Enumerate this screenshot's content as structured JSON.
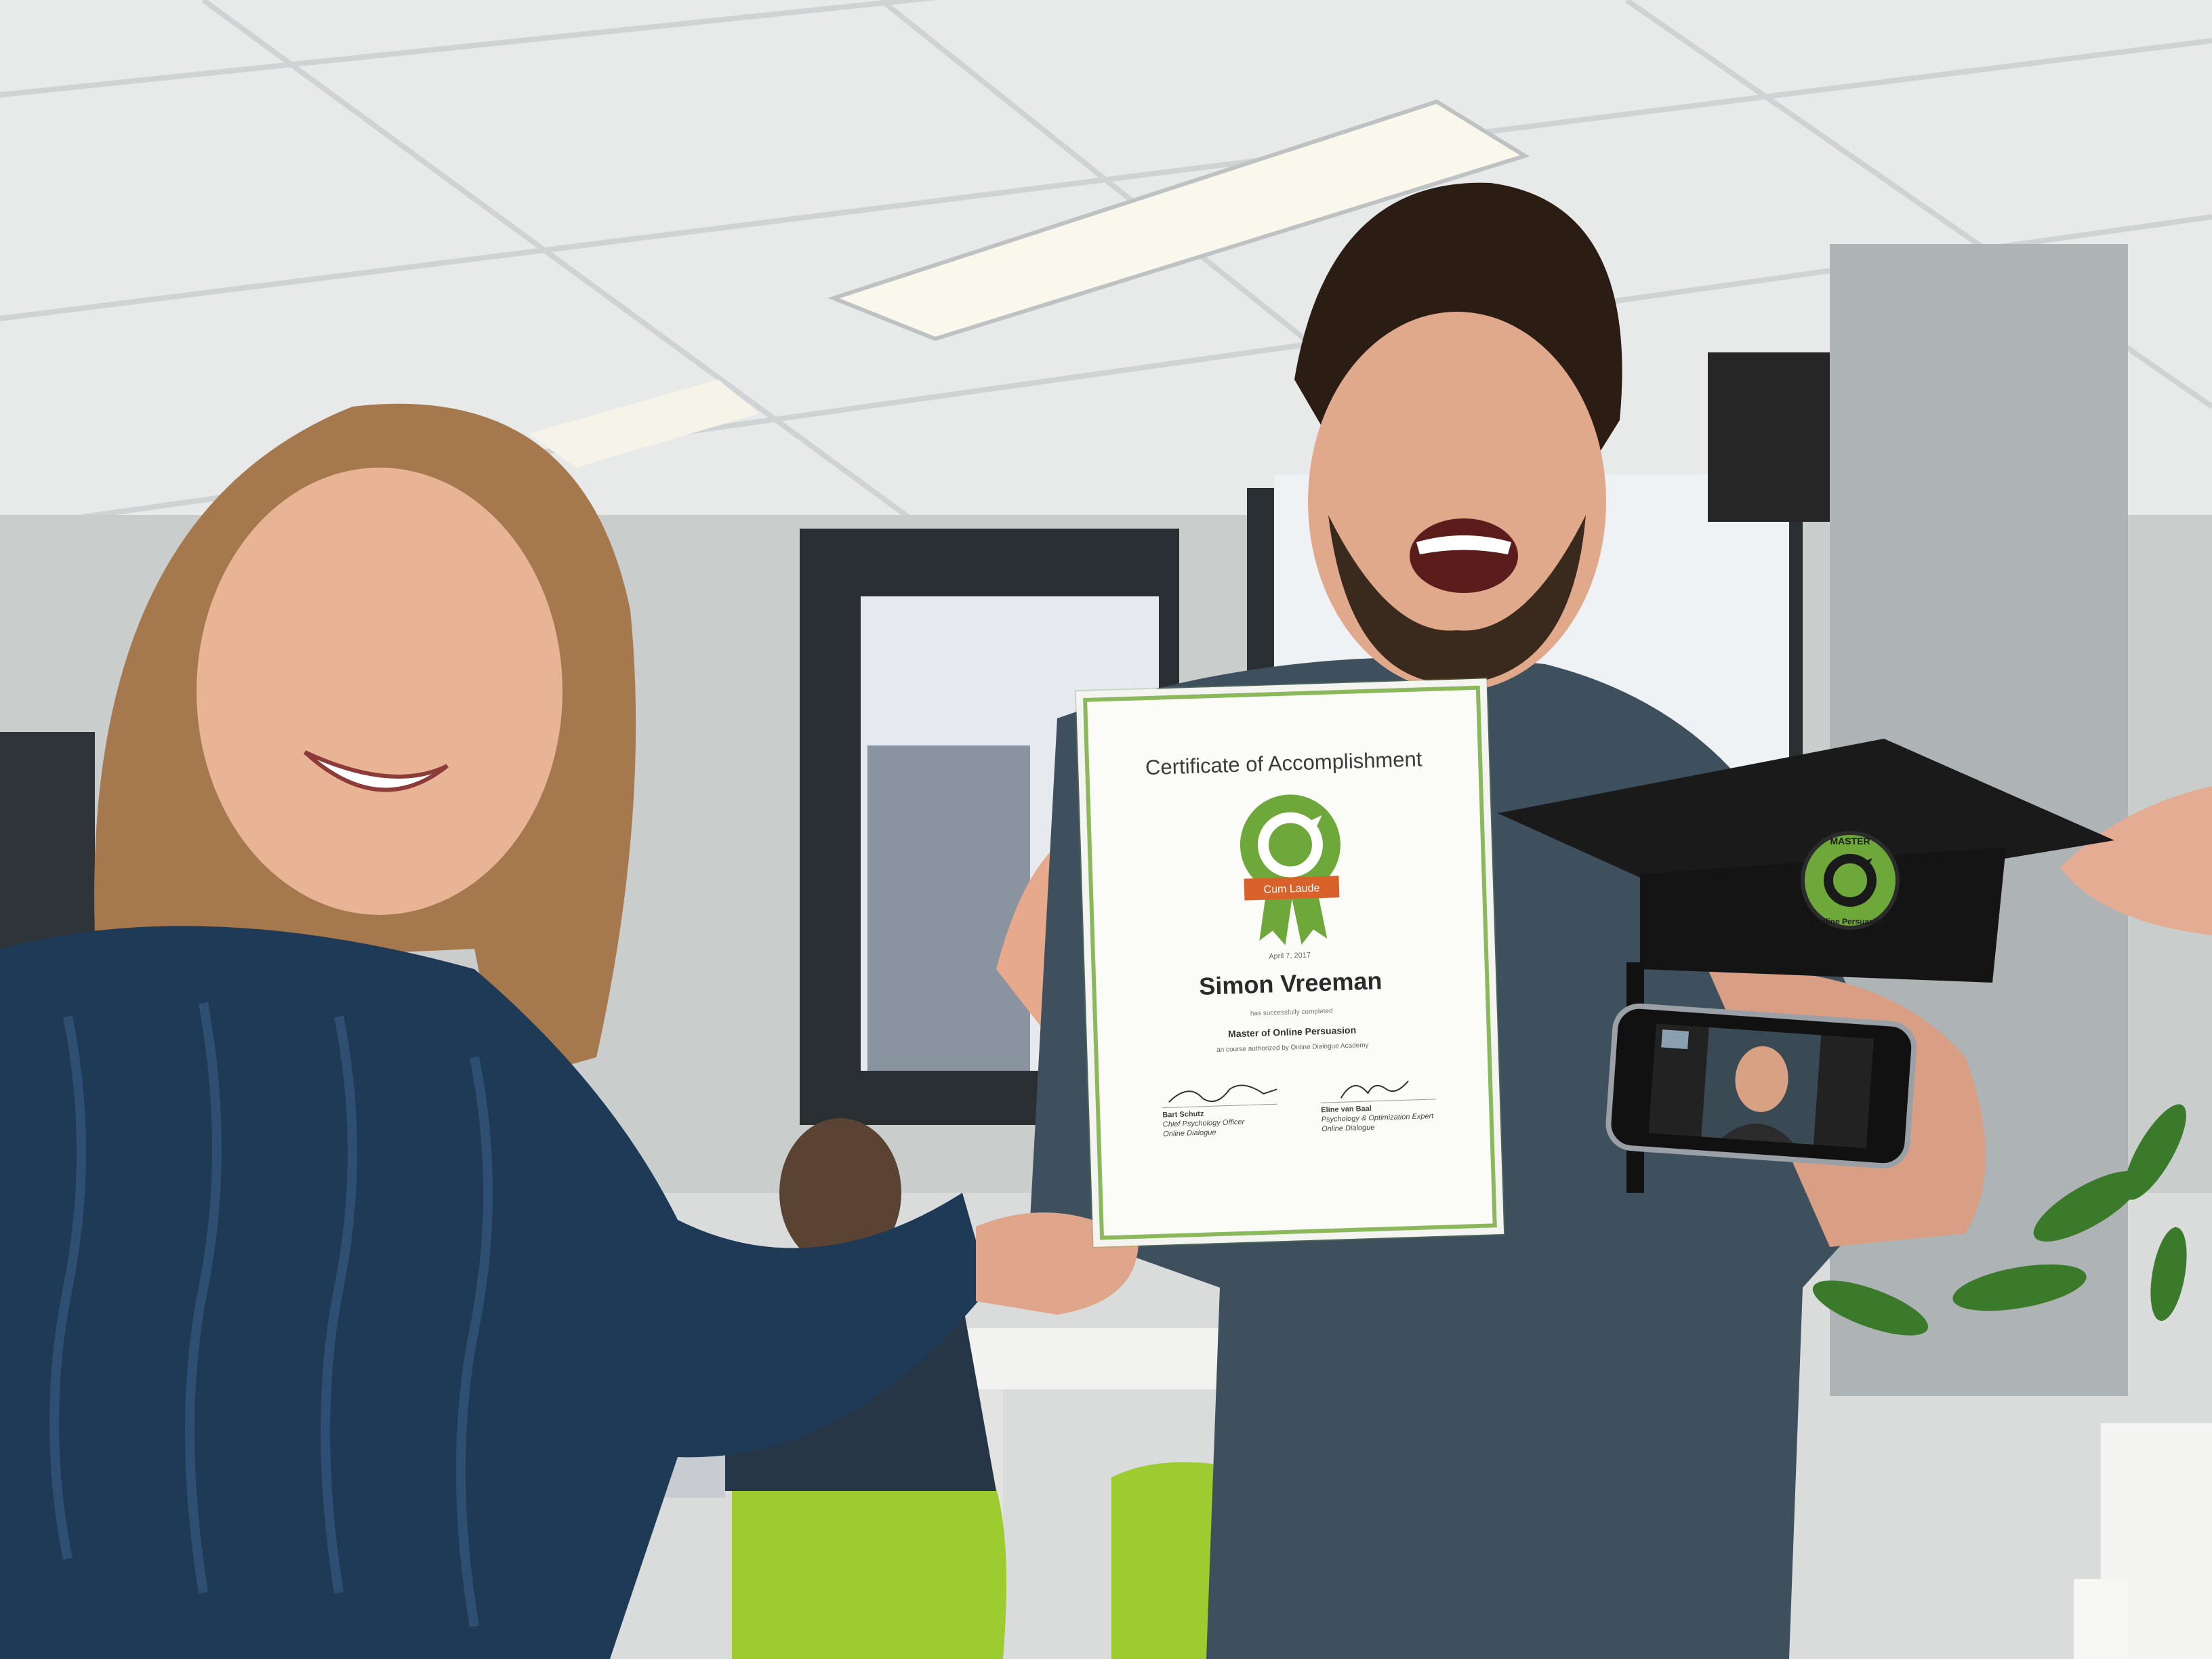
{
  "certificate": {
    "title": "Certificate of Accomplishment",
    "badge": "Cum Laude",
    "date": "April 7, 2017",
    "recipient": "Simon Vreeman",
    "completed_text": "has successfully completed",
    "course": "Master of Online Persuasion",
    "authorized_text": "an course authorized by Online Dialogue Academy",
    "signatories": [
      {
        "name": "Bart Schutz",
        "role": "Chief Psychology Officer",
        "org": "Online Dialogue"
      },
      {
        "name": "Eline van Baal",
        "role": "Psychology & Optimization Expert",
        "org": "Online Dialogue"
      }
    ]
  },
  "cap_emblem": {
    "top_text": "MASTER",
    "bottom_text": "Online Persuasion"
  },
  "colors": {
    "accent_green": "#6fa83a",
    "badge_orange": "#d9622b",
    "sweater_navy": "#1f3a57",
    "shirt_slate": "#3e4f5e",
    "chair_lime": "#9ccc2f",
    "cap_black": "#1a1a1a"
  }
}
